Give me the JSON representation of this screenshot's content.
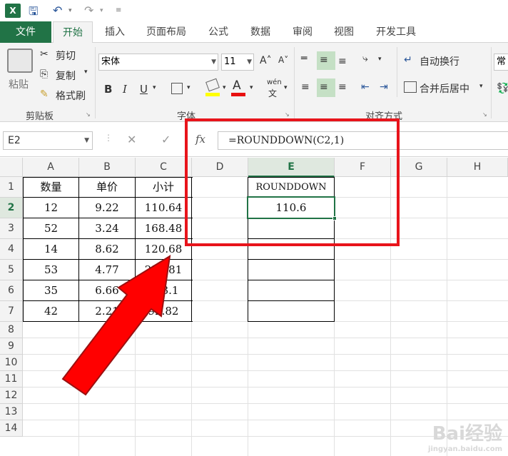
{
  "qat": {
    "app_icon": "excel-icon",
    "items": [
      "save-icon",
      "undo-icon",
      "redo-icon",
      "customize-icon"
    ]
  },
  "tabs": [
    "文件",
    "开始",
    "插入",
    "页面布局",
    "公式",
    "数据",
    "审阅",
    "视图",
    "开发工具"
  ],
  "active_tab": "开始",
  "ribbon": {
    "clipboard": {
      "paste": "粘贴",
      "cut": "剪切",
      "copy": "复制",
      "format_painter": "格式刷",
      "label": "剪贴板"
    },
    "font": {
      "name": "宋体",
      "size": "11",
      "label": "字体",
      "bold": "B",
      "italic": "I",
      "underline": "U",
      "phonetic": "wén"
    },
    "alignment": {
      "wrap": "自动换行",
      "merge": "合并后居中",
      "label": "对齐方式"
    },
    "number": {
      "format_partial": "常"
    }
  },
  "formula_bar": {
    "name_box": "E2",
    "fx": "fx",
    "formula": "=ROUNDDOWN(C2,1)"
  },
  "columns": [
    "A",
    "B",
    "C",
    "D",
    "E",
    "F",
    "G",
    "H"
  ],
  "rows": [
    "1",
    "2",
    "3",
    "4",
    "5",
    "6",
    "7",
    "8",
    "9",
    "10",
    "11",
    "12",
    "13",
    "14"
  ],
  "selected_cell": {
    "col": "E",
    "row": "2"
  },
  "headers": {
    "a": "数量",
    "b": "单价",
    "c": "小计",
    "e": "ROUNDDOWN"
  },
  "table": [
    {
      "a": "12",
      "b": "9.22",
      "c": "110.64",
      "e": "110.6"
    },
    {
      "a": "52",
      "b": "3.24",
      "c": "168.48",
      "e": ""
    },
    {
      "a": "14",
      "b": "8.62",
      "c": "120.68",
      "e": ""
    },
    {
      "a": "53",
      "b": "4.77",
      "c": "252.81",
      "e": ""
    },
    {
      "a": "35",
      "b": "6.66",
      "c": "233.1",
      "e": ""
    },
    {
      "a": "42",
      "b": "2.21",
      "c": "92.82",
      "e": ""
    }
  ],
  "annotation": {
    "highlight_color": "#e8141b",
    "arrow_color": "#ff0000"
  },
  "watermark": {
    "brand": "Bai经验",
    "url": "jingyan.baidu.com"
  }
}
